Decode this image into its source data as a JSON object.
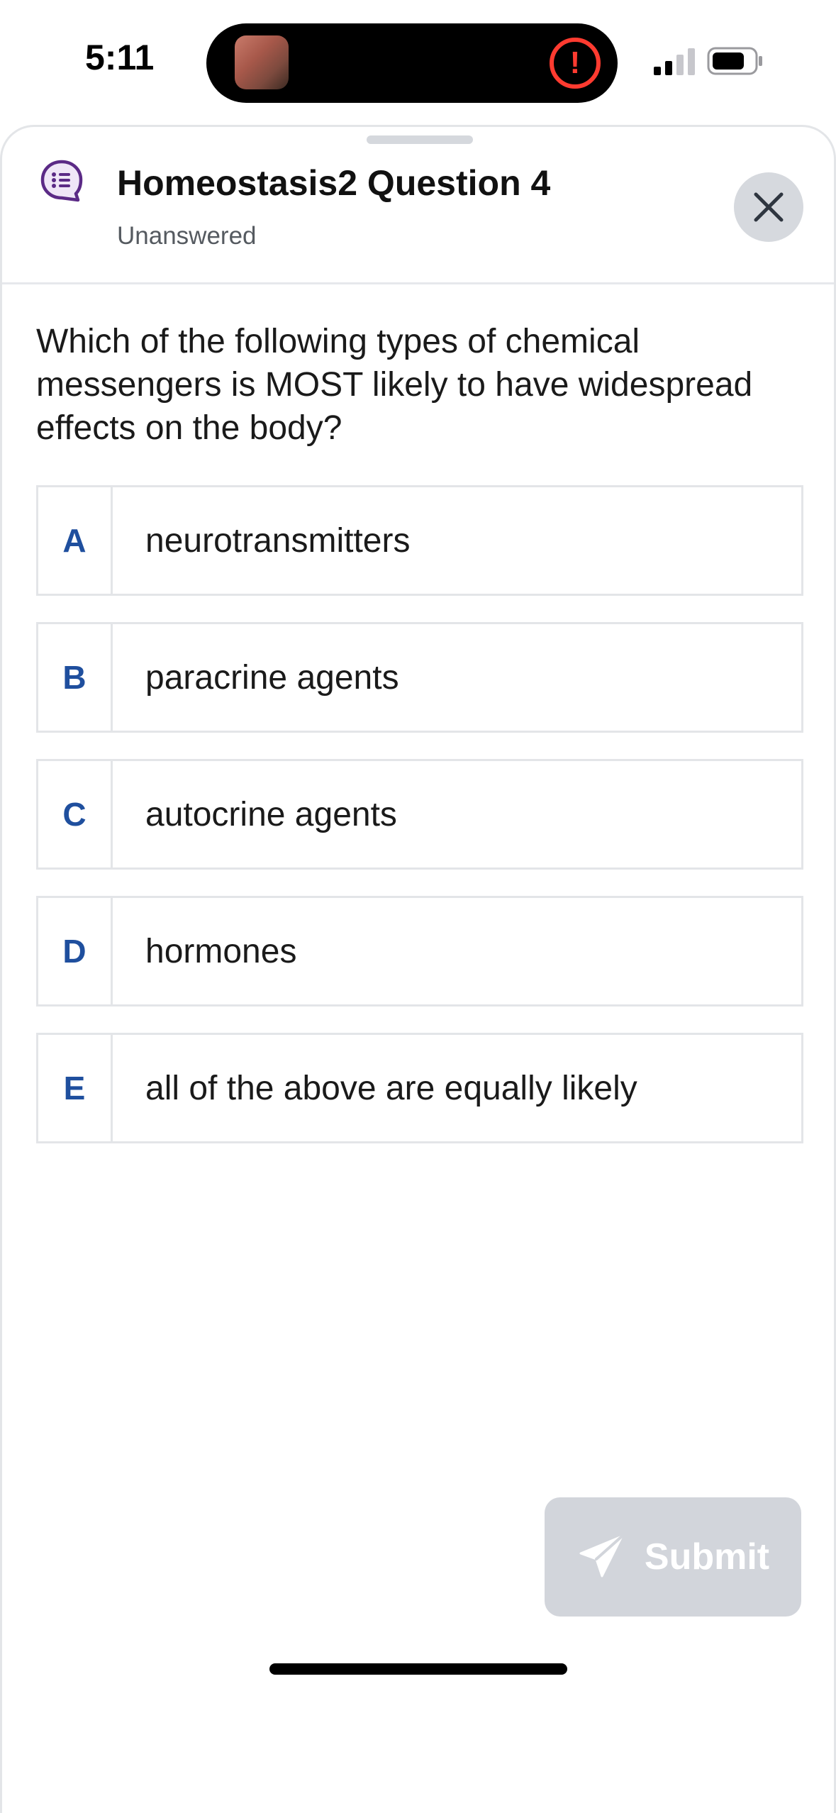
{
  "status_bar": {
    "time": "5:11",
    "alert_glyph": "!",
    "alert_color": "#ff3b30"
  },
  "header": {
    "title": "Homeostasis2 Question 4",
    "subtitle": "Unanswered",
    "icon": "chat-list-icon",
    "icon_color": "#5b2a86"
  },
  "question": {
    "text": "Which of the following types of chemical messengers is MOST likely to have widespread effects on the body?"
  },
  "options": [
    {
      "letter": "A",
      "text": "neurotransmitters"
    },
    {
      "letter": "B",
      "text": "paracrine agents"
    },
    {
      "letter": "C",
      "text": "autocrine agents"
    },
    {
      "letter": "D",
      "text": "hormones"
    },
    {
      "letter": "E",
      "text": "all of the above are equally likely"
    }
  ],
  "submit": {
    "label": "Submit",
    "icon": "send-icon",
    "state": "disabled"
  },
  "colors": {
    "letter": "#1f4f9e",
    "submit_bg": "#d2d5db",
    "border": "#e3e5e8"
  }
}
